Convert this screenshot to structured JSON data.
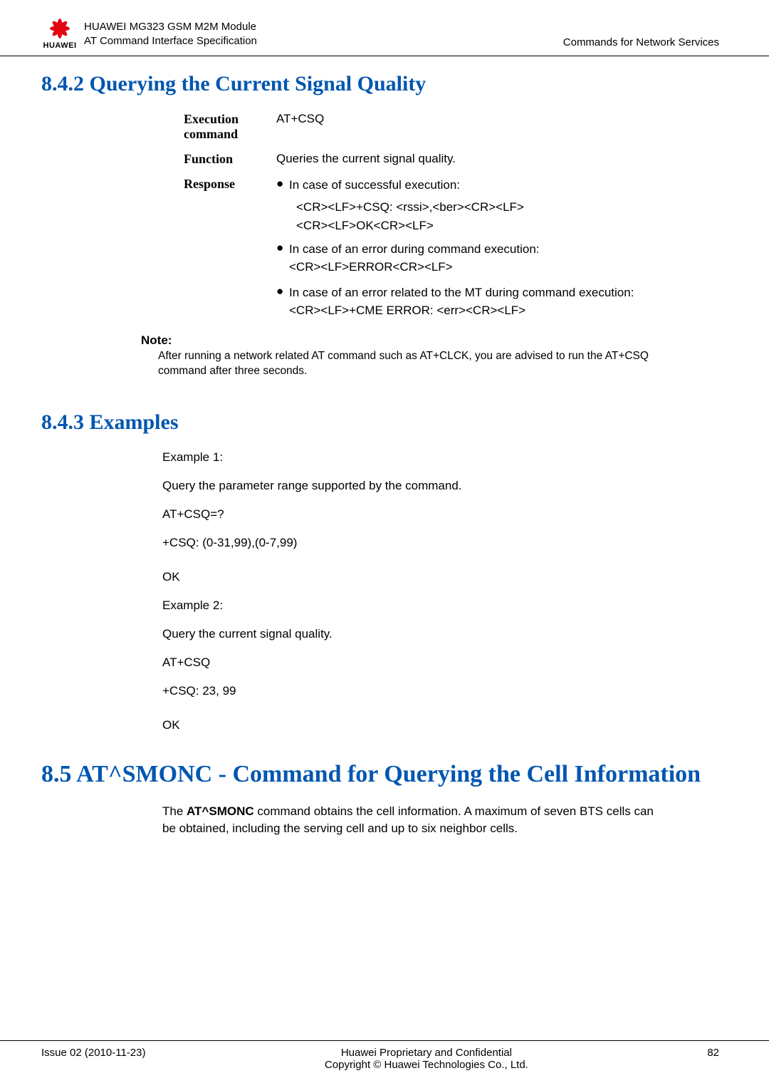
{
  "header": {
    "line1": "HUAWEI MG323 GSM M2M Module",
    "line2": "AT Command Interface Specification",
    "right": "Commands for Network Services",
    "logo_text": "HUAWEI"
  },
  "section842": {
    "heading": "8.4.2 Querying the Current Signal Quality",
    "rows": {
      "exec_label": "Execution command",
      "exec_value": "AT+CSQ",
      "func_label": "Function",
      "func_value": "Queries the current signal quality.",
      "resp_label": "Response",
      "resp_b1": "In case of successful execution:",
      "resp_b1_l1": "<CR><LF>+CSQ: <rssi>,<ber><CR><LF>",
      "resp_b1_l2": "<CR><LF>OK<CR><LF>",
      "resp_b2_l1": "In case of an error during command execution:",
      "resp_b2_l2": "<CR><LF>ERROR<CR><LF>",
      "resp_b3_l1": "In case of an error related to the MT during command execution:",
      "resp_b3_l2": "<CR><LF>+CME ERROR: <err><CR><LF>"
    },
    "note_label": "Note:",
    "note_text": "After running a network related AT command such as AT+CLCK, you are advised to run the AT+CSQ command after three seconds."
  },
  "section843": {
    "heading": "8.4.3 Examples",
    "lines": {
      "ex1": "Example 1:",
      "q1": "Query the parameter range supported by the command.",
      "cmd1": "AT+CSQ=?",
      "out1": "+CSQ: (0-31,99),(0-7,99)",
      "ok1": "OK",
      "ex2": "Example 2:",
      "q2": "Query the current signal quality.",
      "cmd2": "AT+CSQ",
      "out2": "+CSQ: 23, 99",
      "ok2": "OK"
    }
  },
  "section85": {
    "heading": "8.5 AT^SMONC - Command for Querying the Cell Information",
    "body_pre": "The ",
    "body_bold": "AT^SMONC",
    "body_post": " command obtains the cell information. A maximum of seven BTS cells can be obtained, including the serving cell and up to six neighbor cells."
  },
  "footer": {
    "issue": "Issue 02 (2010-11-23)",
    "mid1": "Huawei Proprietary and Confidential",
    "mid2": "Copyright © Huawei Technologies Co., Ltd.",
    "page": "82"
  }
}
